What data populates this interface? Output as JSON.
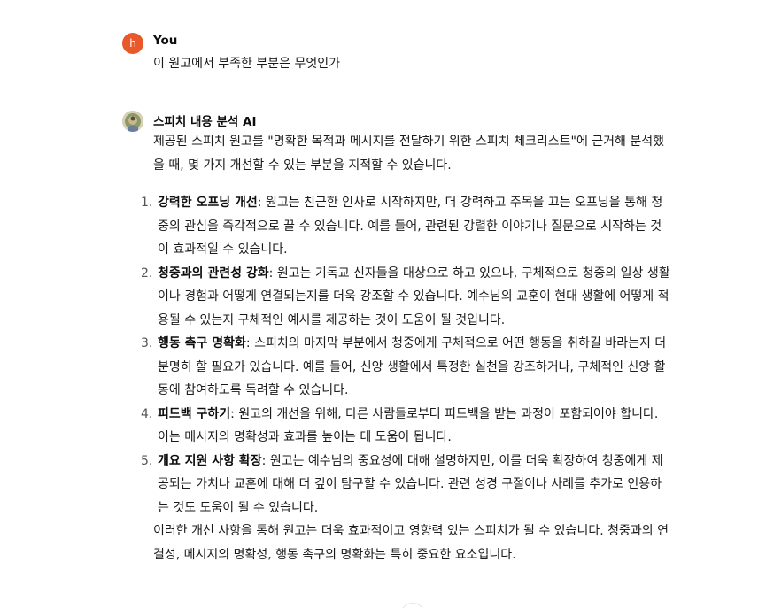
{
  "user_message": {
    "avatar_letter": "h",
    "author": "You",
    "text": "이 원고에서 부족한 부분은 무엇인가"
  },
  "ai_message": {
    "author": "스피치 내용 분석 AI",
    "intro": "제공된 스피치 원고를 \"명확한 목적과 메시지를 전달하기 위한 스피치 체크리스트\"에 근거해 분석했을 때, 몇 가지 개선할 수 있는 부분을 지적할 수 있습니다.",
    "items": [
      {
        "number": "1.",
        "title": "강력한 오프닝 개선",
        "text": ": 원고는 친근한 인사로 시작하지만, 더 강력하고 주목을 끄는 오프닝을 통해 청중의 관심을 즉각적으로 끌 수 있습니다. 예를 들어, 관련된 강렬한 이야기나 질문으로 시작하는 것이 효과적일 수 있습니다."
      },
      {
        "number": "2.",
        "title": "청중과의 관련성 강화",
        "text": ": 원고는 기독교 신자들을 대상으로 하고 있으나, 구체적으로 청중의 일상 생활이나 경험과 어떻게 연결되는지를 더욱 강조할 수 있습니다. 예수님의 교훈이 현대 생활에 어떻게 적용될 수 있는지 구체적인 예시를 제공하는 것이 도움이 될 것입니다."
      },
      {
        "number": "3.",
        "title": "행동 촉구 명확화",
        "text": ": 스피치의 마지막 부분에서 청중에게 구체적으로 어떤 행동을 취하길 바라는지 더 분명히 할 필요가 있습니다. 예를 들어, 신앙 생활에서 특정한 실천을 강조하거나, 구체적인 신앙 활동에 참여하도록 독려할 수 있습니다."
      },
      {
        "number": "4.",
        "title": "피드백 구하기",
        "text": ": 원고의 개선을 위해, 다른 사람들로부터 피드백을 받는 과정이 포함되어야 합니다. 이는 메시지의 명확성과 효과를 높이는 데 도움이 됩니다."
      },
      {
        "number": "5.",
        "title": "개요 지원 사항 확장",
        "text": ": 원고는 예수님의 중요성에 대해 설명하지만, 이를 더욱 확장하여 청중에게 제공되는 가치나 교훈에 대해 더 깊이 탐구할 수 있습니다. 관련 성경 구절이나 사례를 추가로 인용하는 것도 도움이 될 수 있습니다."
      }
    ],
    "closing": "이러한 개선 사항을 통해 원고는 더욱 효과적이고 영향력 있는 스피치가 될 수 있습니다. 청중과의 연결성, 메시지의 명확성, 행동 촉구의 명확화는 특히 중요한 요소입니다."
  },
  "colors": {
    "user_avatar_bg": "#e8582a",
    "background": "#ffffff",
    "text": "#0d0d0d"
  }
}
